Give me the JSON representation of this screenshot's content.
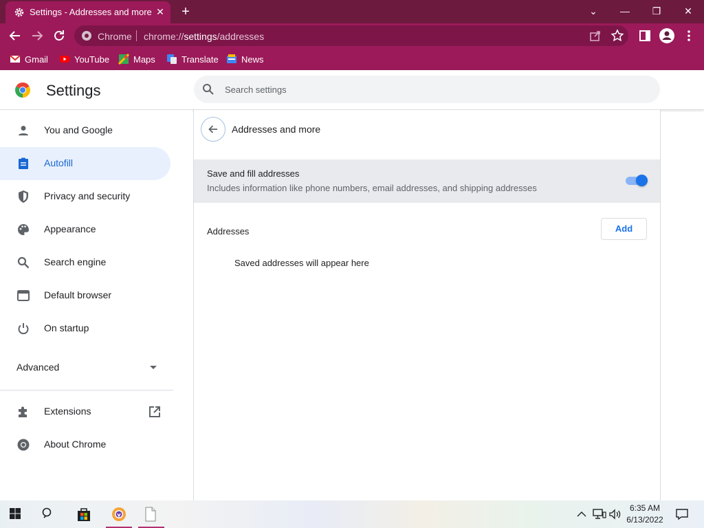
{
  "window": {
    "tab_title": "Settings - Addresses and more",
    "tab_close": "✕",
    "new_tab": "+",
    "minimize": "⌄",
    "maximize": "—",
    "restore": "❐",
    "close": "✕"
  },
  "toolbar": {
    "site_name": "Chrome",
    "url_prefix": "chrome://",
    "url_host": "settings",
    "url_path": "/addresses"
  },
  "bookmarks": [
    {
      "label": "Gmail",
      "icon": "gmail-icon"
    },
    {
      "label": "YouTube",
      "icon": "youtube-icon"
    },
    {
      "label": "Maps",
      "icon": "maps-icon"
    },
    {
      "label": "Translate",
      "icon": "translate-icon"
    },
    {
      "label": "News",
      "icon": "news-icon"
    }
  ],
  "header": {
    "title": "Settings",
    "search_placeholder": "Search settings"
  },
  "sidebar": {
    "items": [
      {
        "label": "You and Google",
        "icon": "person-icon"
      },
      {
        "label": "Autofill",
        "icon": "clipboard-icon",
        "active": true
      },
      {
        "label": "Privacy and security",
        "icon": "shield-icon"
      },
      {
        "label": "Appearance",
        "icon": "palette-icon"
      },
      {
        "label": "Search engine",
        "icon": "search-icon"
      },
      {
        "label": "Default browser",
        "icon": "browser-icon"
      },
      {
        "label": "On startup",
        "icon": "power-icon"
      }
    ],
    "advanced_label": "Advanced",
    "extensions_label": "Extensions",
    "about_label": "About Chrome"
  },
  "main": {
    "page_title": "Addresses and more",
    "toggle_title": "Save and fill addresses",
    "toggle_subtitle": "Includes information like phone numbers, email addresses, and shipping addresses",
    "toggle_on": true,
    "addresses_label": "Addresses",
    "add_button": "Add",
    "empty_message": "Saved addresses will appear here"
  },
  "taskbar": {
    "time": "6:35 AM",
    "date": "6/13/2022"
  },
  "colors": {
    "frame": "#9c1a5a",
    "titlebar": "#6d1a3f",
    "accent": "#1a73e8",
    "active_nav_bg": "#e8f0fe"
  }
}
